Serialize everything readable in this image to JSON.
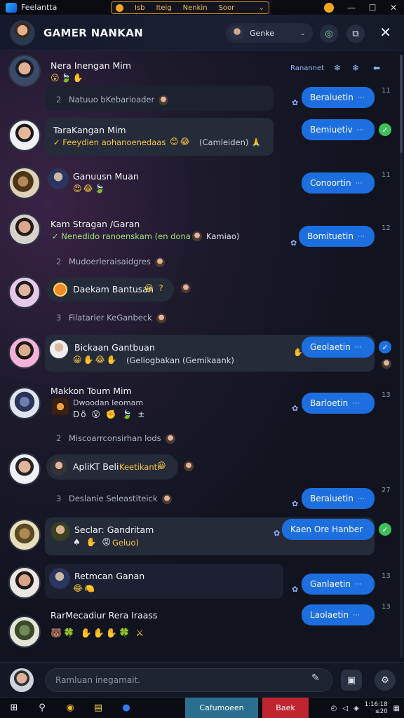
{
  "titlebar": {
    "app_name": "Feelantta",
    "center_items": [
      "Isb",
      "Iteig",
      "Nenkin",
      "Soor"
    ],
    "controls": [
      "—",
      "☐",
      "✕"
    ]
  },
  "header": {
    "title": "GAMER NANKAN",
    "pill_label": "Genke",
    "close": "✕"
  },
  "chat": {
    "conversations": [
      {
        "name": "Nera Inengan Mim",
        "emoji": "😮🍃✋"
      },
      {
        "name": "TaraKangan Mim",
        "sub": "✓ Feeydien aohanoenedaas",
        "emoji_after": "😊😂",
        "tail": "(Camleiden) 🙏"
      },
      {
        "name": "Ganuusn Muan",
        "emoji": "😍😂🍃"
      },
      {
        "name": "Kam Stragan /Garan",
        "sub": "✓ Nenedido ranoenskam (en dona",
        "tail": "Kamiao)"
      },
      {
        "name": "Daekam Bantusan",
        "emoji_after": "😀 ?"
      },
      {
        "name": "Bickaan Gantbuan",
        "emoji": "😀✋😂✋",
        "tail": "(Geliogbakan (Gemikaank)"
      },
      {
        "name": "Makkon Toum Mim",
        "sub2": "Dwoodan Ieomam",
        "emoji": "Dö 😮 ✊ 🍃 ±"
      },
      {
        "name": "ApliKT Beli",
        "tag": "Keetikanti",
        "emoji_after": "😀"
      },
      {
        "name": "Seclar: Gandritam",
        "emoji": "♠ ✋ 😡",
        "tag": "Geluo)"
      },
      {
        "name": "Retmcan Ganan",
        "emoji": "😂🍋"
      },
      {
        "name": "RarMecadiur Rera Iraass",
        "emoji": "🐻🍀 ✋✋✋🍀 ⚔"
      }
    ],
    "system_lines": [
      {
        "n": "2",
        "text": "Natuuo bKebarioader"
      },
      {
        "n": "2",
        "text": "Mudoerleraisaidgres"
      },
      {
        "n": "3",
        "text": "Filatarier KeGanbeck"
      },
      {
        "n": "2",
        "text": "Miscoarrconsirhan lods"
      },
      {
        "n": "3",
        "text": "Deslanie Seleastiteick"
      }
    ],
    "top_right": {
      "label": "Ranannet",
      "icons": [
        "❄",
        "❄",
        "⬅"
      ]
    },
    "outgoing": [
      {
        "text": "Beraiuetin",
        "time": "11"
      },
      {
        "text": "Bemiuetiv",
        "check": true
      },
      {
        "text": "Conoortin",
        "time": "11"
      },
      {
        "text": "Bomituetin",
        "time": "12"
      },
      {
        "text": "Geolaetin",
        "check": true
      },
      {
        "text": "Barloetin",
        "time": "13"
      },
      {
        "text": "Beraiuetin",
        "time": "27"
      },
      {
        "text": "Kaen Ore Hanber",
        "check": true
      },
      {
        "text": "Ganlaetin",
        "time": "13"
      },
      {
        "text": "Laolaetin",
        "time": "13"
      }
    ],
    "bubble_tail": "⋯"
  },
  "composer": {
    "placeholder": "Ramluan inegamait."
  },
  "taskbar": {
    "task1": "Cafumoeen",
    "task2": "Baek",
    "clock_line1": "1:16:18",
    "clock_line2": "≤20"
  },
  "colors": {
    "accent": "#1d6fe0",
    "check": "#3fbf5a",
    "highlight": "#f4c542",
    "green_text": "#9fe27a"
  }
}
